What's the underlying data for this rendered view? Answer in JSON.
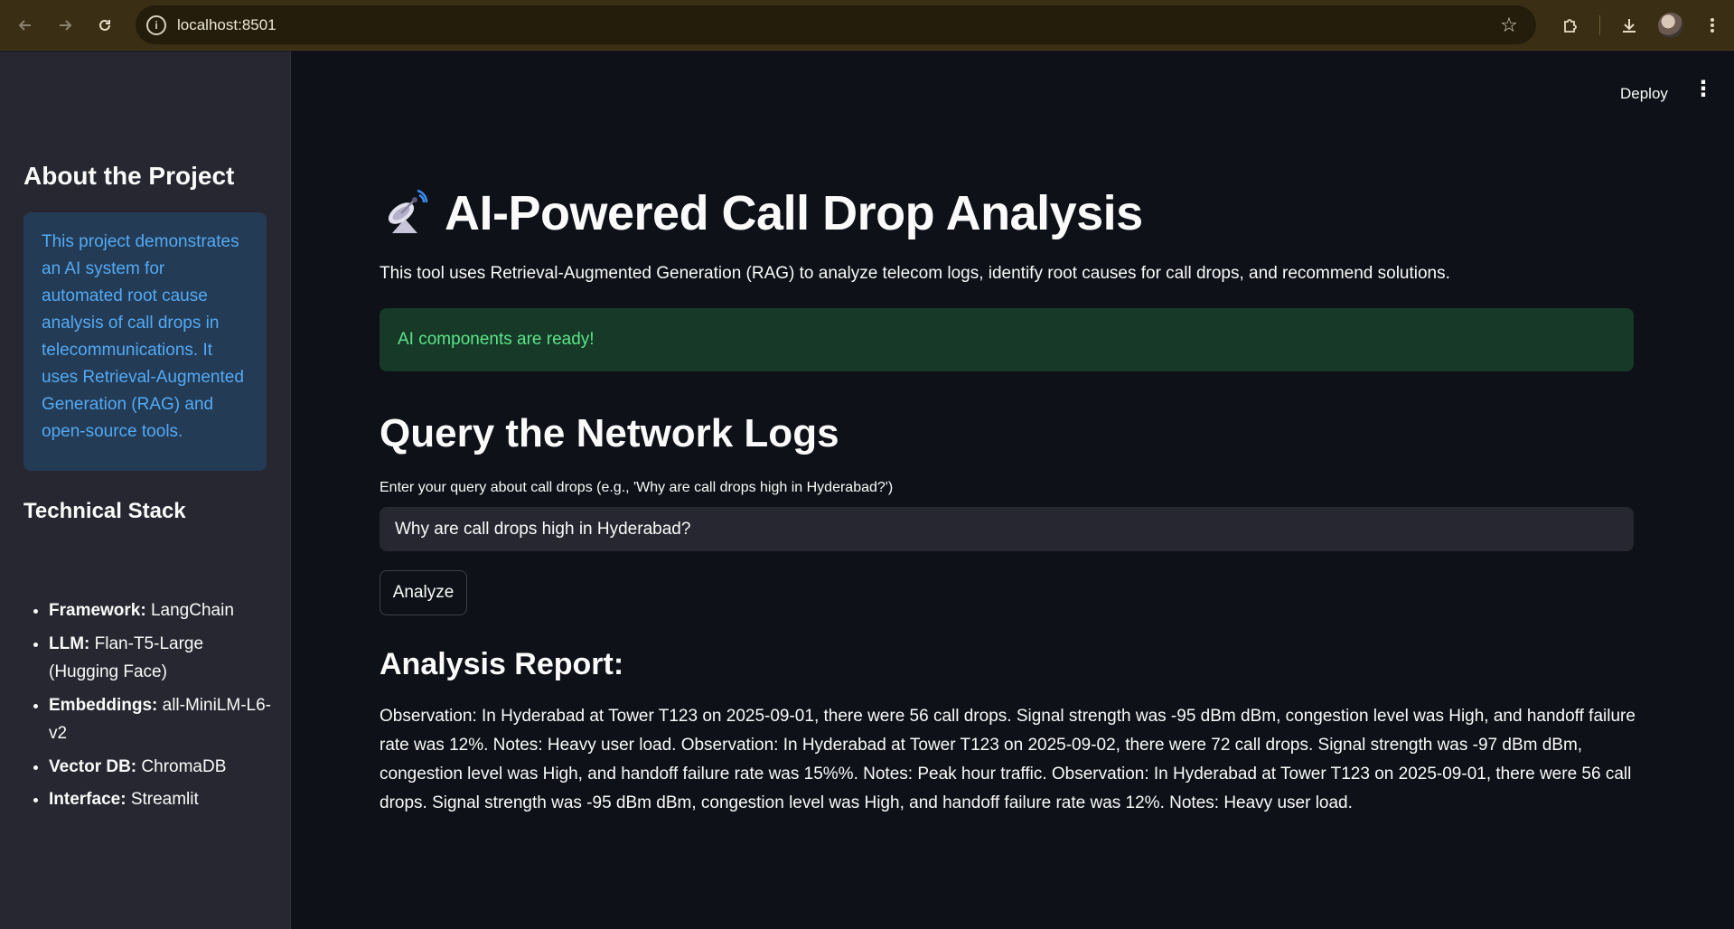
{
  "browser": {
    "url": "localhost:8501",
    "back_icon": "arrow-left",
    "forward_icon": "arrow-right",
    "reload_icon": "reload",
    "site_info_icon": "info",
    "bookmark_icon": "star",
    "extensions_icon": "puzzle",
    "download_icon": "download",
    "menu_icon": "kebab"
  },
  "header": {
    "deploy_label": "Deploy",
    "menu_label": "⋮"
  },
  "sidebar": {
    "about_heading": "About the Project",
    "about_text": "This project demonstrates an AI system for automated root cause analysis of call drops in telecommunications. It uses Retrieval-Augmented Generation (RAG) and open-source tools.",
    "stack_heading": "Technical Stack",
    "stack": [
      {
        "key": "Framework:",
        "value": "LangChain"
      },
      {
        "key": "LLM:",
        "value": "Flan-T5-Large (Hugging Face)"
      },
      {
        "key": "Embeddings:",
        "value": "all-MiniLM-L6-v2"
      },
      {
        "key": "Vector DB:",
        "value": "ChromaDB"
      },
      {
        "key": "Interface:",
        "value": "Streamlit"
      }
    ]
  },
  "main": {
    "title": "AI-Powered Call Drop Analysis",
    "title_icon": "satellite-antenna",
    "intro": "This tool uses Retrieval-Augmented Generation (RAG) to analyze telecom logs, identify root causes for call drops, and recommend solutions.",
    "success_message": "AI components are ready!",
    "query_heading": "Query the Network Logs",
    "query_label": "Enter your query about call drops (e.g., 'Why are call drops high in Hyderabad?')",
    "query_value": "Why are call drops high in Hyderabad?",
    "analyze_label": "Analyze",
    "report_heading": "Analysis Report:",
    "report_text": "Observation: In Hyderabad at Tower T123 on 2025-09-01, there were 56 call drops. Signal strength was -95 dBm dBm, congestion level was High, and handoff failure rate was 12%. Notes: Heavy user load. Observation: In Hyderabad at Tower T123 on 2025-09-02, there were 72 call drops. Signal strength was -97 dBm dBm, congestion level was High, and handoff failure rate was 15%%. Notes: Peak hour traffic. Observation: In Hyderabad at Tower T123 on 2025-09-01, there were 56 call drops. Signal strength was -95 dBm dBm, congestion level was High, and handoff failure rate was 12%. Notes: Heavy user load."
  }
}
